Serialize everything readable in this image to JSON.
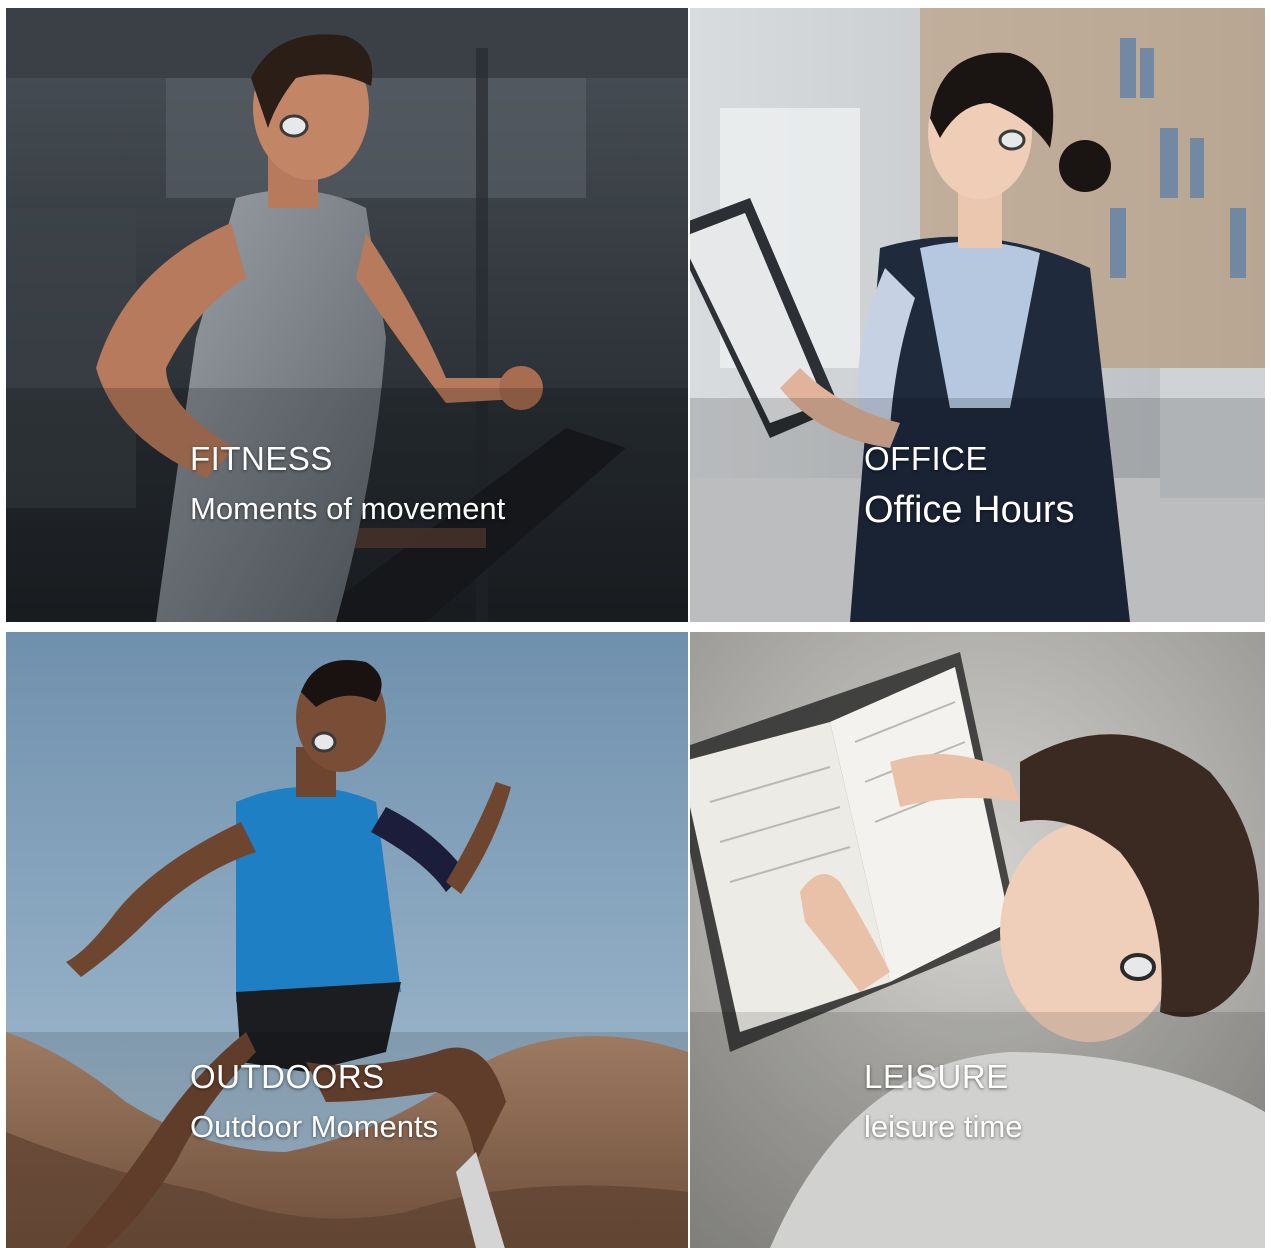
{
  "panels": {
    "fitness": {
      "category": "FITNESS",
      "subtitle": "Moments of movement"
    },
    "office": {
      "category": "OFFICE",
      "subtitle": "Office Hours"
    },
    "outdoors": {
      "category": "OUTDOORS",
      "subtitle": "Outdoor Moments"
    },
    "leisure": {
      "category": "LEISURE",
      "subtitle": "leisure time"
    }
  },
  "colors": {
    "caption_text": "#ffffff",
    "gutter": "#ffffff",
    "gym_dark": "#2b3036",
    "office_light": "#cfd3d6",
    "sky_blue": "#8fb0cc",
    "rug_gray": "#b9b9b5"
  },
  "icons": {
    "earbud": "earbud-icon"
  }
}
